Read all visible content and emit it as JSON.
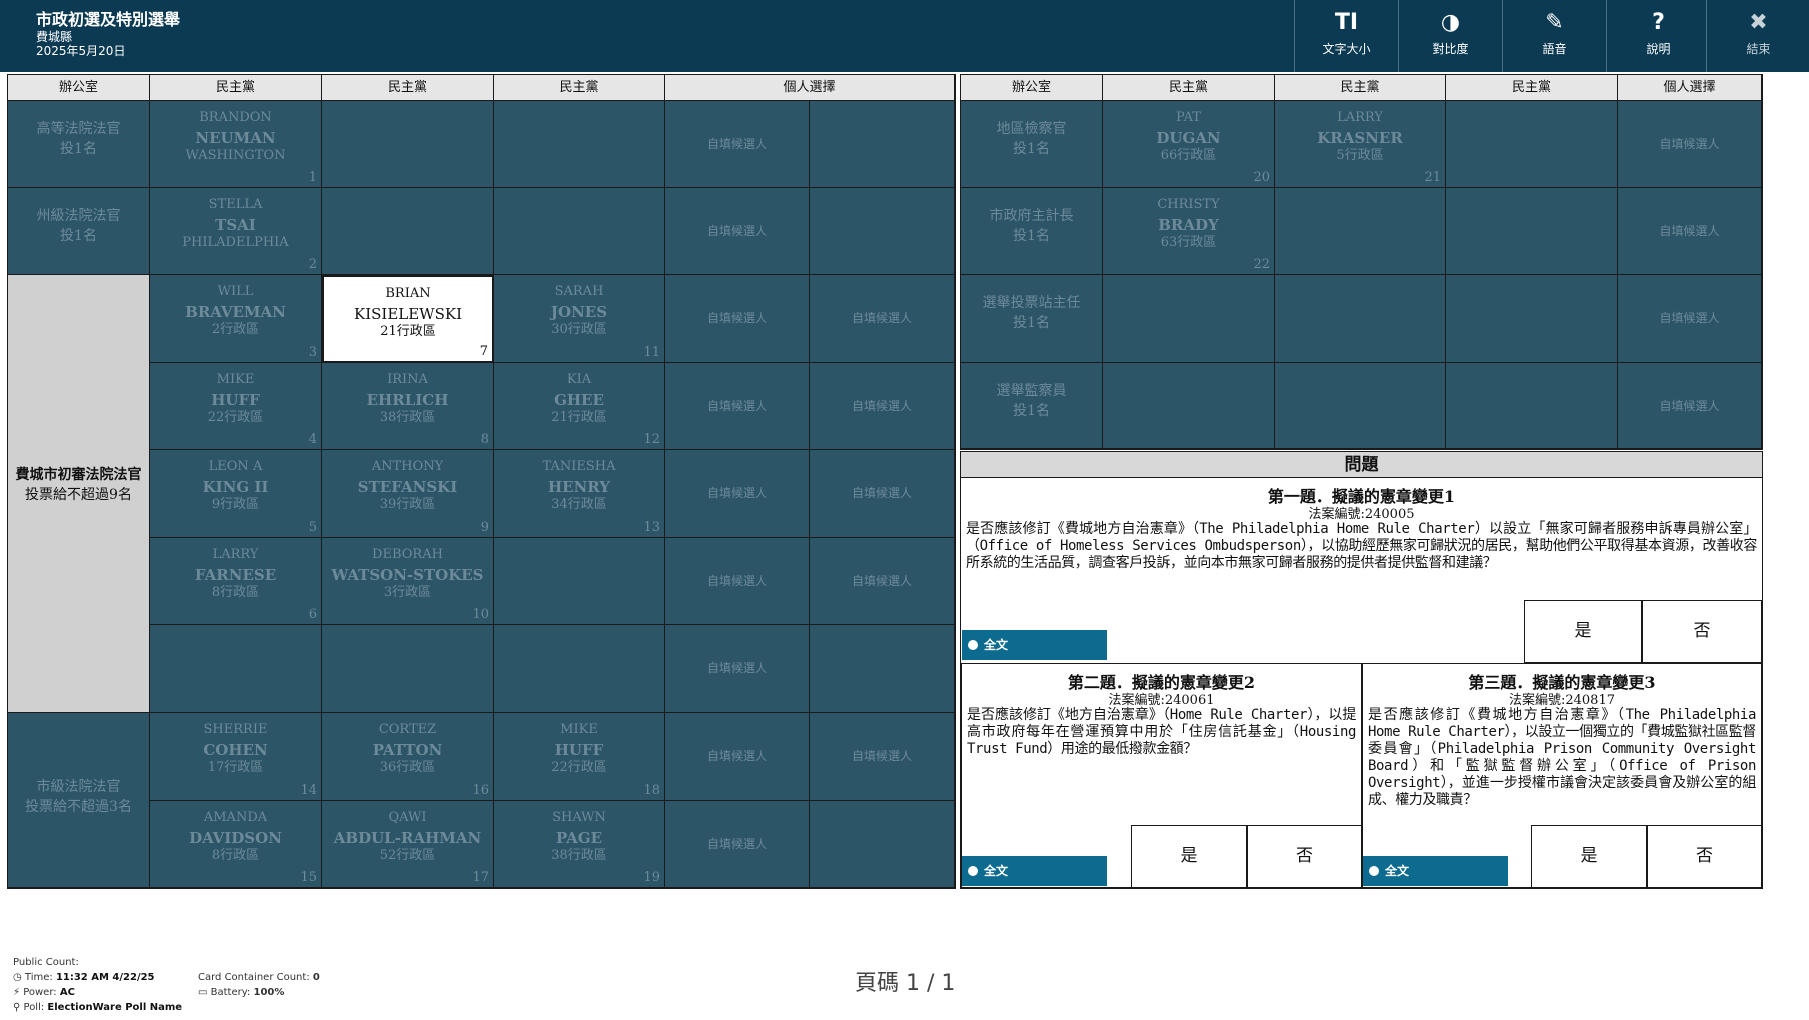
{
  "header": {
    "title": "市政初選及特別選舉",
    "county": "費城縣",
    "date": "2025年5月20日",
    "tools": [
      {
        "icon": "TI",
        "label": "文字大小"
      },
      {
        "icon": "◑",
        "label": "對比度"
      },
      {
        "icon": "✎",
        "label": "語音"
      },
      {
        "icon": "?",
        "label": "說明"
      },
      {
        "icon": "✖",
        "label": "結束"
      }
    ]
  },
  "columns": {
    "office": "辦公室",
    "dem": "民主黨",
    "writein": "個人選擇"
  },
  "writein_label": "自填候選人",
  "left_contests": [
    {
      "office": "高等法院法官",
      "instruction": "投1名"
    },
    {
      "office": "州級法院法官",
      "instruction": "投1名"
    },
    {
      "office": "費城市初審法院法官",
      "instruction": "投票給不超過9名"
    },
    {
      "office": "市級法院法官",
      "instruction": "投票給不超過3名"
    }
  ],
  "right_contests": [
    {
      "office": "地區檢察官",
      "instruction": "投1名"
    },
    {
      "office": "市政府主計長",
      "instruction": "投1名"
    },
    {
      "office": "選舉投票站主任",
      "instruction": "投1名"
    },
    {
      "office": "選舉監察員",
      "instruction": "投1名"
    }
  ],
  "candidates": {
    "neuman": {
      "first": "BRANDON",
      "last": "NEUMAN",
      "district": "WASHINGTON",
      "num": "1"
    },
    "tsai": {
      "first": "STELLA",
      "last": "TSAI",
      "district": "PHILADELPHIA",
      "num": "2"
    },
    "braveman": {
      "first": "WILL",
      "last": "BRAVEMAN",
      "district": "2行政區",
      "num": "3"
    },
    "kisielewski": {
      "first": "BRIAN",
      "last": "KISIELEWSKI",
      "district": "21行政區",
      "num": "7"
    },
    "jones": {
      "first": "SARAH",
      "last": "JONES",
      "district": "30行政區",
      "num": "11"
    },
    "huff1": {
      "first": "MIKE",
      "last": "HUFF",
      "district": "22行政區",
      "num": "4"
    },
    "ehrlich": {
      "first": "IRINA",
      "last": "EHRLICH",
      "district": "38行政區",
      "num": "8"
    },
    "ghee": {
      "first": "KIA",
      "last": "GHEE",
      "district": "21行政區",
      "num": "12"
    },
    "king": {
      "first": "LEON A",
      "last": "KING II",
      "district": "9行政區",
      "num": "5"
    },
    "stefanski": {
      "first": "ANTHONY",
      "last": "STEFANSKI",
      "district": "39行政區",
      "num": "9"
    },
    "henry": {
      "first": "TANIESHA",
      "last": "HENRY",
      "district": "34行政區",
      "num": "13"
    },
    "farnese": {
      "first": "LARRY",
      "last": "FARNESE",
      "district": "8行政區",
      "num": "6"
    },
    "watson": {
      "first": "DEBORAH",
      "last": "WATSON-STOKES",
      "district": "3行政區",
      "num": "10"
    },
    "cohen": {
      "first": "SHERRIE",
      "last": "COHEN",
      "district": "17行政區",
      "num": "14"
    },
    "patton": {
      "first": "CORTEZ",
      "last": "PATTON",
      "district": "36行政區",
      "num": "16"
    },
    "huff2": {
      "first": "MIKE",
      "last": "HUFF",
      "district": "22行政區",
      "num": "18"
    },
    "davidson": {
      "first": "AMANDA",
      "last": "DAVIDSON",
      "district": "8行政區",
      "num": "15"
    },
    "abdul": {
      "first": "QAWI",
      "last": "ABDUL-RAHMAN",
      "district": "52行政區",
      "num": "17"
    },
    "page": {
      "first": "SHAWN",
      "last": "PAGE",
      "district": "38行政區",
      "num": "19"
    },
    "dugan": {
      "first": "PAT",
      "last": "DUGAN",
      "district": "66行政區",
      "num": "20"
    },
    "krasner": {
      "first": "LARRY",
      "last": "KRASNER",
      "district": "5行政區",
      "num": "21"
    },
    "brady": {
      "first": "CHRISTY",
      "last": "BRADY",
      "district": "63行政區",
      "num": "22"
    }
  },
  "questions": {
    "header": "問題",
    "full_text_label": "全文",
    "yes": "是",
    "no": "否",
    "q1": {
      "title": "第一題．擬議的憲章變更1",
      "bill": "法案編號:240005",
      "text": "是否應該修訂《費城地方自治憲章》（The Philadelphia Home Rule Charter）以設立「無家可歸者服務申訴專員辦公室」（Office of Homeless Services Ombudsperson），以協助經歷無家可歸狀況的居民，幫助他們公平取得基本資源，改善收容所系統的生活品質，調查客戶投訴，並向本市無家可歸者服務的提供者提供監督和建議？"
    },
    "q2": {
      "title": "第二題．擬議的憲章變更2",
      "bill": "法案編號:240061",
      "text": "是否應該修訂《地方自治憲章》（Home Rule Charter），以提高市政府每年在營運預算中用於「住房信託基金」（Housing Trust Fund）用途的最低撥款金額？"
    },
    "q3": {
      "title": "第三題．擬議的憲章變更3",
      "bill": "法案編號:240817",
      "text": "是否應該修訂《費城地方自治憲章》（The Philadelphia Home Rule Charter），以設立一個獨立的「費城監獄社區監督委員會」（Philadelphia Prison Community Oversight Board）和「監獄監督辦公室」（Office of Prison Oversight），並進一步授權市議會決定該委員會及辦公室的組成、權力及職責？"
    }
  },
  "footer": {
    "public_count_label": "Public Count:",
    "time_label": "Time:",
    "time_value": "11:32 AM 4/22/25",
    "power_label": "Power:",
    "power_value": "AC",
    "poll_label": "Poll:",
    "poll_value": "ElectionWare Poll Name",
    "card_label": "Card Container Count:",
    "card_value": "0",
    "battery_label": "Battery:",
    "battery_value": "100%",
    "page": "頁碼 1 / 1"
  }
}
